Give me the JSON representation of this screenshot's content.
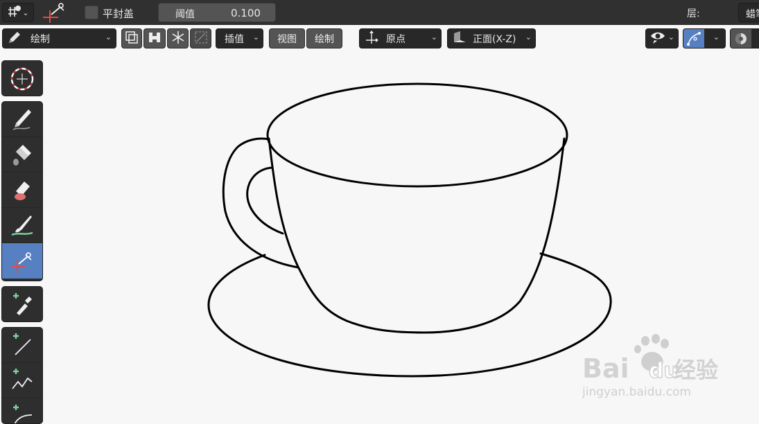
{
  "topbar": {
    "fill_caps_label": "平封盖",
    "threshold_label": "阈值",
    "threshold_value": "0.100",
    "layer_label": "层:",
    "layer_value": "蜡笔"
  },
  "header": {
    "mode_label": "绘制",
    "interpolate_label": "插值",
    "view_label": "视图",
    "draw_label": "绘制",
    "origin_label": "原点",
    "orientation_label": "正面(X-Z)"
  },
  "toolbar": {
    "tools": [
      "cursor-tool",
      "draw-tool",
      "fill-tool",
      "erase-tool",
      "tint-tool",
      "cutter-tool",
      "eyedropper-tool",
      "line-tool",
      "polyline-tool",
      "arc-tool"
    ],
    "active_tool": "cutter-tool"
  },
  "watermark": {
    "brand_text_a": "Bai",
    "brand_text_b": "du",
    "brand_text_cn": "经验",
    "url": "jingyan.baidu.com"
  },
  "colors": {
    "accent": "#5680c2",
    "panel": "#303030",
    "canvas": "#f7f7f7",
    "stroke": "#000000"
  }
}
